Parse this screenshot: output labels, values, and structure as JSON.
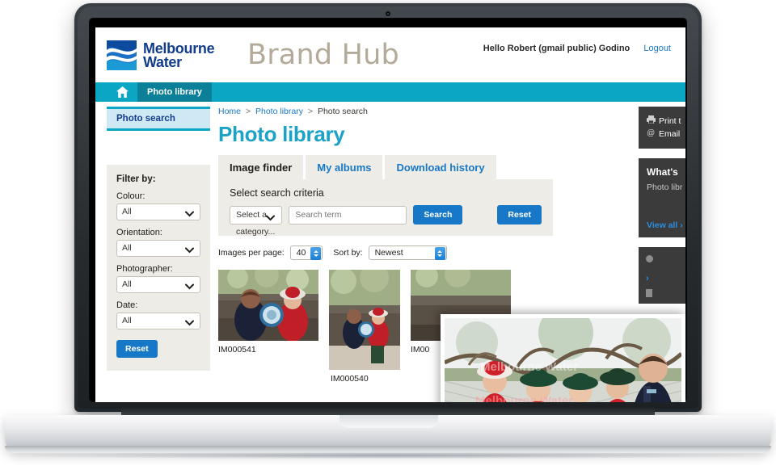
{
  "header": {
    "logo_line1": "Melbourne",
    "logo_line2": "Water",
    "brand_title": "Brand Hub",
    "greeting": "Hello Robert (gmail public) Godino",
    "logout_label": "Logout"
  },
  "nav": {
    "home_icon": "home-icon",
    "active_item": "Photo library"
  },
  "sidebar_left": {
    "section_label": "Photo search",
    "filter_title": "Filter by:",
    "filters": [
      {
        "label": "Colour:",
        "value": "All"
      },
      {
        "label": "Orientation:",
        "value": "All"
      },
      {
        "label": "Photographer:",
        "value": "All"
      },
      {
        "label": "Date:",
        "value": "All"
      }
    ],
    "reset_label": "Reset"
  },
  "breadcrumb": {
    "home": "Home",
    "library": "Photo library",
    "current": "Photo search",
    "separator": ">"
  },
  "page": {
    "title": "Photo library"
  },
  "tabs": [
    {
      "label": "Image finder",
      "active": true
    },
    {
      "label": "My albums",
      "active": false
    },
    {
      "label": "Download history",
      "active": false
    }
  ],
  "search": {
    "panel_title": "Select search criteria",
    "category_value": "Select a category...",
    "term_placeholder": "Search term",
    "search_label": "Search",
    "reset_label": "Reset"
  },
  "results": {
    "per_page_label": "Images per page:",
    "per_page_value": "40",
    "sort_label": "Sort by:",
    "sort_value": "Newest",
    "thumbnails": [
      {
        "caption": "IM000541"
      },
      {
        "caption": "IM000540"
      },
      {
        "caption": "IM00"
      }
    ]
  },
  "sidebar_right": {
    "print_label": "Print t",
    "print_icon": "printer-icon",
    "email_label": "Email",
    "email_icon": "at-icon",
    "whats_new_title": "What's",
    "whats_new_text": "Photo libr",
    "view_all_label": "View all",
    "view_all_chevron": "›"
  },
  "popup": {
    "watermark": "Melbourne Water"
  },
  "colors": {
    "brand_blue": "#123c8c",
    "teal": "#0aa6c4",
    "title_teal": "#1aa3c6",
    "link_blue": "#1878c8",
    "panel_beige": "#eeece7",
    "dark_panel": "#3b3b3b",
    "brandhub_grey": "#b3aa9a"
  }
}
